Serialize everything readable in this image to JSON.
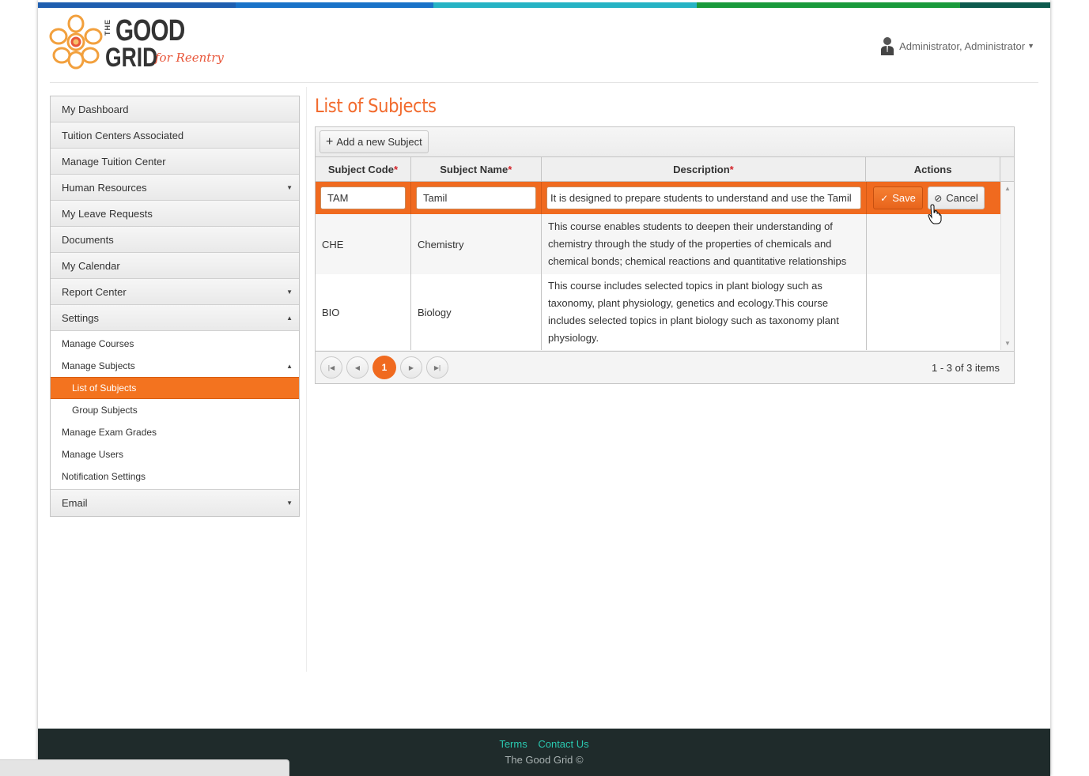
{
  "brand": {
    "logo_the": "THE",
    "logo_good": "GOOD",
    "logo_grid": "GRID",
    "logo_tagline": "for Reentry",
    "topbar_colors": [
      "#1f5fb0",
      "#1a73c8",
      "#27b3c4",
      "#1a9a3c",
      "#0d5a4e"
    ]
  },
  "user": {
    "name": "Administrator, Administrator",
    "icon": "user-avatar-icon"
  },
  "sidebar": {
    "items": [
      {
        "label": "My Dashboard"
      },
      {
        "label": "Tuition Centers Associated"
      },
      {
        "label": "Manage Tuition Center"
      },
      {
        "label": "Human Resources",
        "expandable": true
      },
      {
        "label": "My Leave Requests"
      },
      {
        "label": "Documents"
      },
      {
        "label": "My Calendar"
      },
      {
        "label": "Report Center",
        "expandable": true
      },
      {
        "label": "Settings",
        "expanded": true
      }
    ],
    "settings_sub": [
      {
        "label": "Manage Courses"
      },
      {
        "label": "Manage Subjects",
        "expanded": true
      },
      {
        "label": "List of Subjects",
        "active": true
      },
      {
        "label": "Group Subjects"
      },
      {
        "label": "Manage Exam Grades"
      },
      {
        "label": "Manage Users"
      },
      {
        "label": "Notification Settings"
      }
    ],
    "last_item": {
      "label": "Email",
      "expandable": true
    },
    "accent_color": "#f3731f"
  },
  "page": {
    "title": "List of Subjects"
  },
  "grid": {
    "add_button": "Add a new Subject",
    "columns": {
      "code": "Subject Code",
      "name": "Subject Name",
      "description": "Description",
      "actions": "Actions",
      "required_mark": "*"
    },
    "edit_row": {
      "code": "TAM",
      "name": "Tamil",
      "description": "It is designed to prepare students to understand and use the Tamil",
      "save_label": "Save",
      "cancel_label": "Cancel"
    },
    "rows": [
      {
        "code": "CHE",
        "name": "Chemistry",
        "description": "This course enables students to deepen their understanding of chemistry through the study of the properties of chemicals and chemical bonds; chemical reactions and quantitative relationships"
      },
      {
        "code": "BIO",
        "name": "Biology",
        "description": "This course includes selected topics in plant biology such as taxonomy, plant physiology, genetics and ecology.This course includes selected topics in plant biology such as taxonomy plant physiology."
      }
    ],
    "pager": {
      "current_page": "1",
      "info": "1 - 3 of 3 items"
    }
  },
  "footer": {
    "terms": "Terms",
    "contact": "Contact Us",
    "copyright": "The Good Grid ©"
  }
}
